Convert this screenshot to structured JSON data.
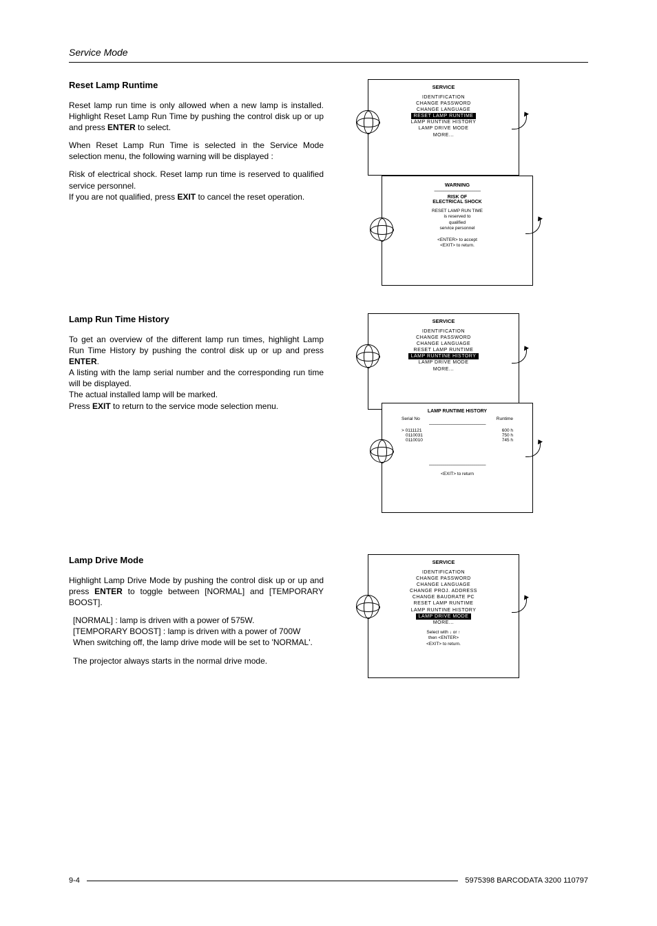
{
  "header": {
    "running": "Service Mode"
  },
  "sec1": {
    "title": "Reset Lamp Runtime",
    "p1a": "Reset lamp run time is only allowed when a new lamp is installed. Highlight Reset Lamp Run Time by pushing the control disk up or up and press ",
    "p1b": "ENTER",
    "p1c": " to select.",
    "p2": "When Reset Lamp Run Time is selected in the Service Mode selection menu, the following warning will be displayed :",
    "p3": "Risk of electrical shock.  Reset lamp run time is reserved to qualified service  personnel.",
    "p4a": "If you are not qualified, press ",
    "p4b": "EXIT",
    "p4c": " to cancel the reset operation."
  },
  "menu1": {
    "title": "SERVICE",
    "l1": "IDENTIFICATION",
    "l2": "CHANGE PASSWORD",
    "l3": "CHANGE LANGUAGE",
    "hl": "RESET LAMP RUNTIME",
    "l5": "LAMP RUNTINE HISTORY",
    "l6": "LAMP DRIVE MODE",
    "l7": "MORE..."
  },
  "warn": {
    "title": "WARNING",
    "dash": "---------------------------------------------",
    "risk1": "RISK OF",
    "risk2": "ELECTRICAL SHOCK",
    "m1": "RESET LAMP RUN TIME",
    "m2": "is reserved to",
    "m3": "qualified",
    "m4": "service personnel",
    "f1": "<ENTER> to accept",
    "f2": "<EXIT> to return."
  },
  "sec2": {
    "title": "Lamp Run Time History",
    "p1a": "To get an overview of the different lamp run times, highlight Lamp Run Time History by pushing the control disk up or up and press ",
    "p1b": "ENTER",
    "p1c": ".",
    "p2": "A listing with the lamp serial number and the corresponding run time will be displayed.",
    "p3": "The actual installed lamp will be marked.",
    "p4a": "Press ",
    "p4b": "EXIT",
    "p4c": " to return to the service mode selection menu."
  },
  "menu2": {
    "title": "SERVICE",
    "l1": "IDENTIFICATION",
    "l2": "CHANGE PASSWORD",
    "l3": "CHANGE LANGUAGE",
    "l4": "RESET LAMP RUNTIME",
    "hl": "LAMP RUNTINE HISTORY",
    "l6": "LAMP DRIVE MODE",
    "l7": "MORE..."
  },
  "hist": {
    "title": "LAMP RUNTIME HISTORY",
    "h1": "Serial No",
    "h2": "Runtime",
    "dash": "-------------------------------------------------------",
    "r1a": "> 0111121",
    "r1b": "600 h",
    "r2a": "0110031",
    "r2b": "750 h",
    "r3a": "0110010",
    "r3b": "745 h",
    "f": "<EXIT> to return"
  },
  "sec3": {
    "title": "Lamp Drive Mode",
    "p1a": "Highlight Lamp Drive Mode by pushing the control disk up or up and press ",
    "p1b": "ENTER",
    "p1c": " to toggle between [NORMAL] and [TEMPORARY BOOST].",
    "p2": "[NORMAL] : lamp is driven with a power of 575W.",
    "p3": "[TEMPORARY BOOST] : lamp is driven with a power of 700W",
    "p4": "When switching off, the lamp drive mode will be set to 'NORMAL'.",
    "p5": "The projector always starts in the normal drive mode."
  },
  "menu3": {
    "title": "SERVICE",
    "l1": "IDENTIFICATION",
    "l2": "CHANGE PASSWORD",
    "l3": "CHANGE LANGUAGE",
    "l4": "CHANGE PROJ. ADDRESS",
    "l5": "CHANGE BAUDRATE PC",
    "l6": "RESET LAMP RUNTIME",
    "l7": "LAMP RUNTINE HISTORY",
    "hl": "LAMP DRIVE MODE",
    "l9": "MORE...",
    "f1": "Select with ↓ or ↑",
    "f2": "then <ENTER>",
    "f3": "<EXIT> to return."
  },
  "footer": {
    "left": "9-4",
    "right": "5975398 BARCODATA 3200 110797"
  }
}
